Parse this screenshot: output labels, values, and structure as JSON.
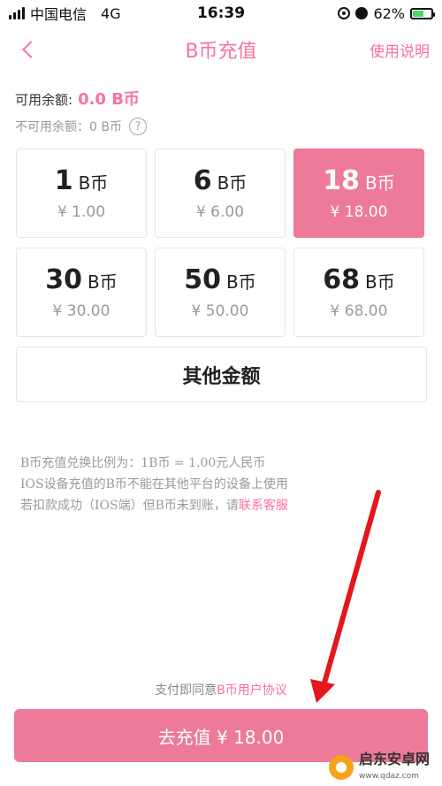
{
  "status_bar": {
    "carrier": "中国电信",
    "network": "4G",
    "time": "16:39",
    "battery": "62%",
    "battery_level": 0.62
  },
  "nav": {
    "back_icon": "chevron-left-icon",
    "title": "B币充值",
    "help": "使用说明"
  },
  "balance": {
    "label": "可用余额:",
    "value": "0.0 B币",
    "unavailable": "不可用余额：0 B币",
    "help_icon": "?"
  },
  "tiles": [
    {
      "num": "1",
      "unit": "B币",
      "price": "¥ 1.00",
      "selected": false
    },
    {
      "num": "6",
      "unit": "B币",
      "price": "¥ 6.00",
      "selected": false
    },
    {
      "num": "18",
      "unit": "B币",
      "price": "¥ 18.00",
      "selected": true
    },
    {
      "num": "30",
      "unit": "B币",
      "price": "¥ 30.00",
      "selected": false
    },
    {
      "num": "50",
      "unit": "B币",
      "price": "¥ 50.00",
      "selected": false
    },
    {
      "num": "68",
      "unit": "B币",
      "price": "¥ 68.00",
      "selected": false
    }
  ],
  "other_amount": "其他金额",
  "notes": {
    "line1": "B币充值兑换比例为：1B币 = 1.00元人民币",
    "line2": "IOS设备充值的B币不能在其他平台的设备上使用",
    "line3_prefix": "若扣款成功（IOS端）但B币未到账，请",
    "line3_link": "联系客服"
  },
  "agreement": {
    "prefix": "支付即同意",
    "link": "B币用户协议"
  },
  "pay_button": "去充值 ¥ 18.00",
  "watermark": {
    "text": "启东安卓网",
    "sub": "www.qdaz.com"
  },
  "colors": {
    "accent": "#fb7299",
    "selected_tile": "#ec7a98",
    "annotation_arrow": "#e3171c"
  }
}
